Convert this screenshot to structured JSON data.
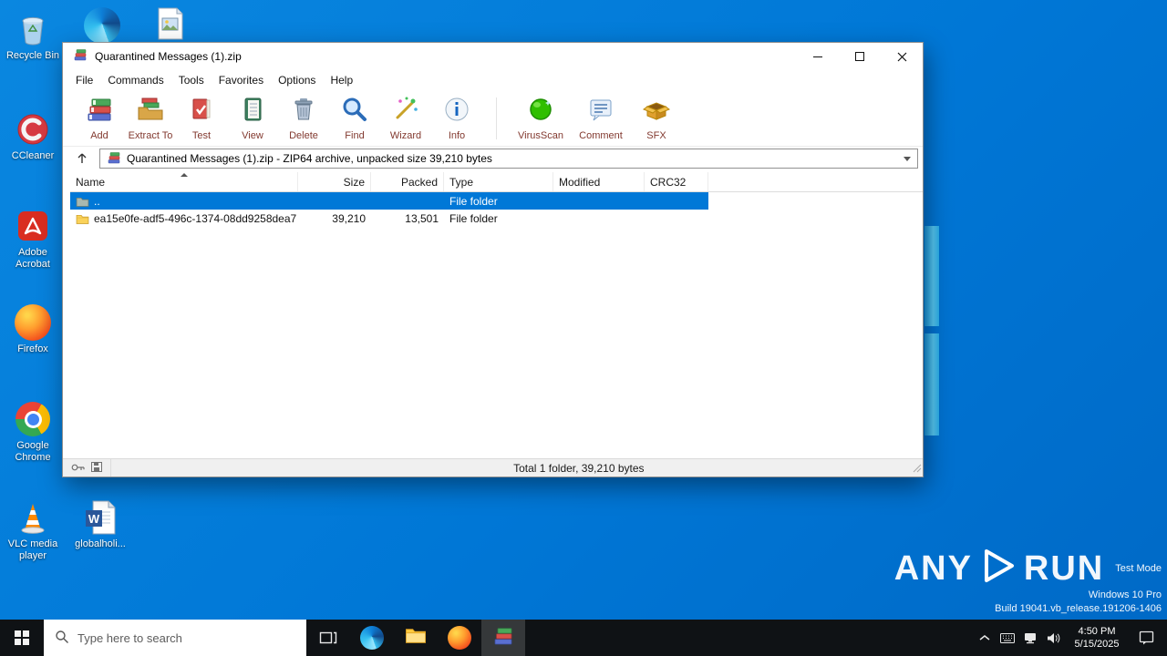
{
  "desktop": {
    "icons": {
      "recycle_bin": "Recycle Bin",
      "ccleaner": "CCleaner",
      "acrobat": "Adobe Acrobat",
      "firefox": "Firefox",
      "chrome": "Google Chrome",
      "vlc": "VLC media player",
      "word_doc": "globalholi..."
    }
  },
  "winrar": {
    "title": "Quarantined Messages (1).zip",
    "menu": [
      "File",
      "Commands",
      "Tools",
      "Favorites",
      "Options",
      "Help"
    ],
    "toolbar": [
      {
        "label": "Add"
      },
      {
        "label": "Extract To"
      },
      {
        "label": "Test"
      },
      {
        "label": "View"
      },
      {
        "label": "Delete"
      },
      {
        "label": "Find"
      },
      {
        "label": "Wizard"
      },
      {
        "label": "Info"
      },
      {
        "label": "VirusScan"
      },
      {
        "label": "Comment"
      },
      {
        "label": "SFX"
      }
    ],
    "address": "Quarantined Messages (1).zip - ZIP64 archive, unpacked size 39,210 bytes",
    "columns": [
      "Name",
      "Size",
      "Packed",
      "Type",
      "Modified",
      "CRC32"
    ],
    "rows": [
      {
        "name": "..",
        "size": "",
        "packed": "",
        "type": "File folder",
        "modified": "",
        "crc32": ""
      },
      {
        "name": "ea15e0fe-adf5-496c-1374-08dd9258dea7",
        "size": "39,210",
        "packed": "13,501",
        "type": "File folder",
        "modified": "",
        "crc32": ""
      }
    ],
    "status_total": "Total 1 folder, 39,210 bytes"
  },
  "taskbar": {
    "search_placeholder": "Type here to search",
    "clock": {
      "time": "4:50 PM",
      "date": "5/15/2025"
    }
  },
  "watermark": {
    "brand_left": "ANY",
    "brand_right": "RUN",
    "mode": "Test Mode",
    "os": "Windows 10 Pro",
    "build": "Build 19041.vb_release.191206-1406"
  }
}
